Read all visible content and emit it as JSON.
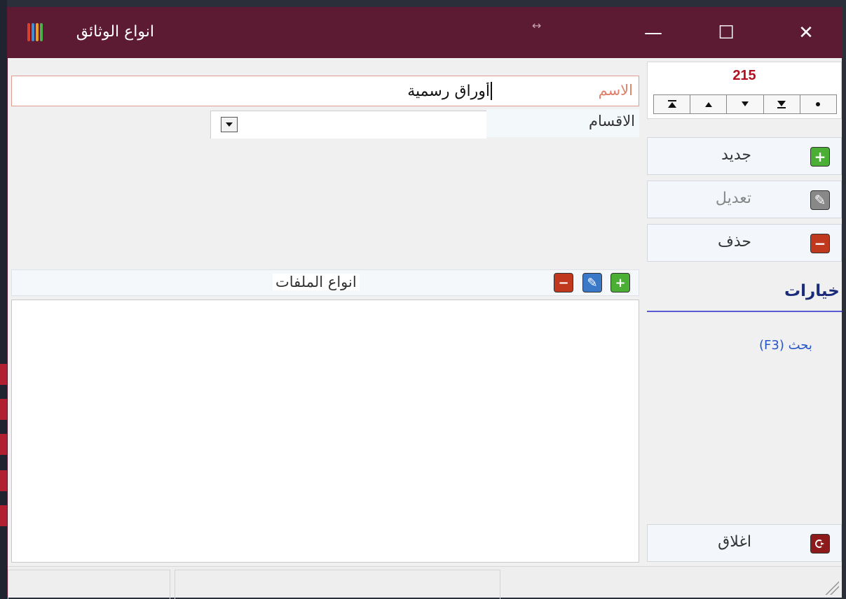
{
  "window": {
    "title": "انواع الوثائق",
    "drag_hint": "↔",
    "minimize": "—",
    "maximize": "☐",
    "close": "✕"
  },
  "navigator": {
    "record_number": "215",
    "buttons": [
      "▲̲",
      "▲",
      "▼",
      "▼̲",
      "●"
    ]
  },
  "actions": {
    "new_label": "جديد",
    "edit_label": "تعديل",
    "delete_label": "حذف",
    "close_label": "اغلاق"
  },
  "options": {
    "title": "خيارات",
    "search_link": "بحث  (F3)"
  },
  "form": {
    "name_label": "الاسم",
    "name_value": "أوراق رسمية",
    "departments_label": "الاقسام",
    "departments_value": ""
  },
  "files": {
    "title": "انواع الملفات",
    "add": "+",
    "edit": "✎",
    "delete": "−",
    "rows": []
  },
  "colors": {
    "titlebar": "#5d1a33",
    "record_number": "#b01020",
    "options_title": "#1a2b7a",
    "link": "#2456c8"
  }
}
